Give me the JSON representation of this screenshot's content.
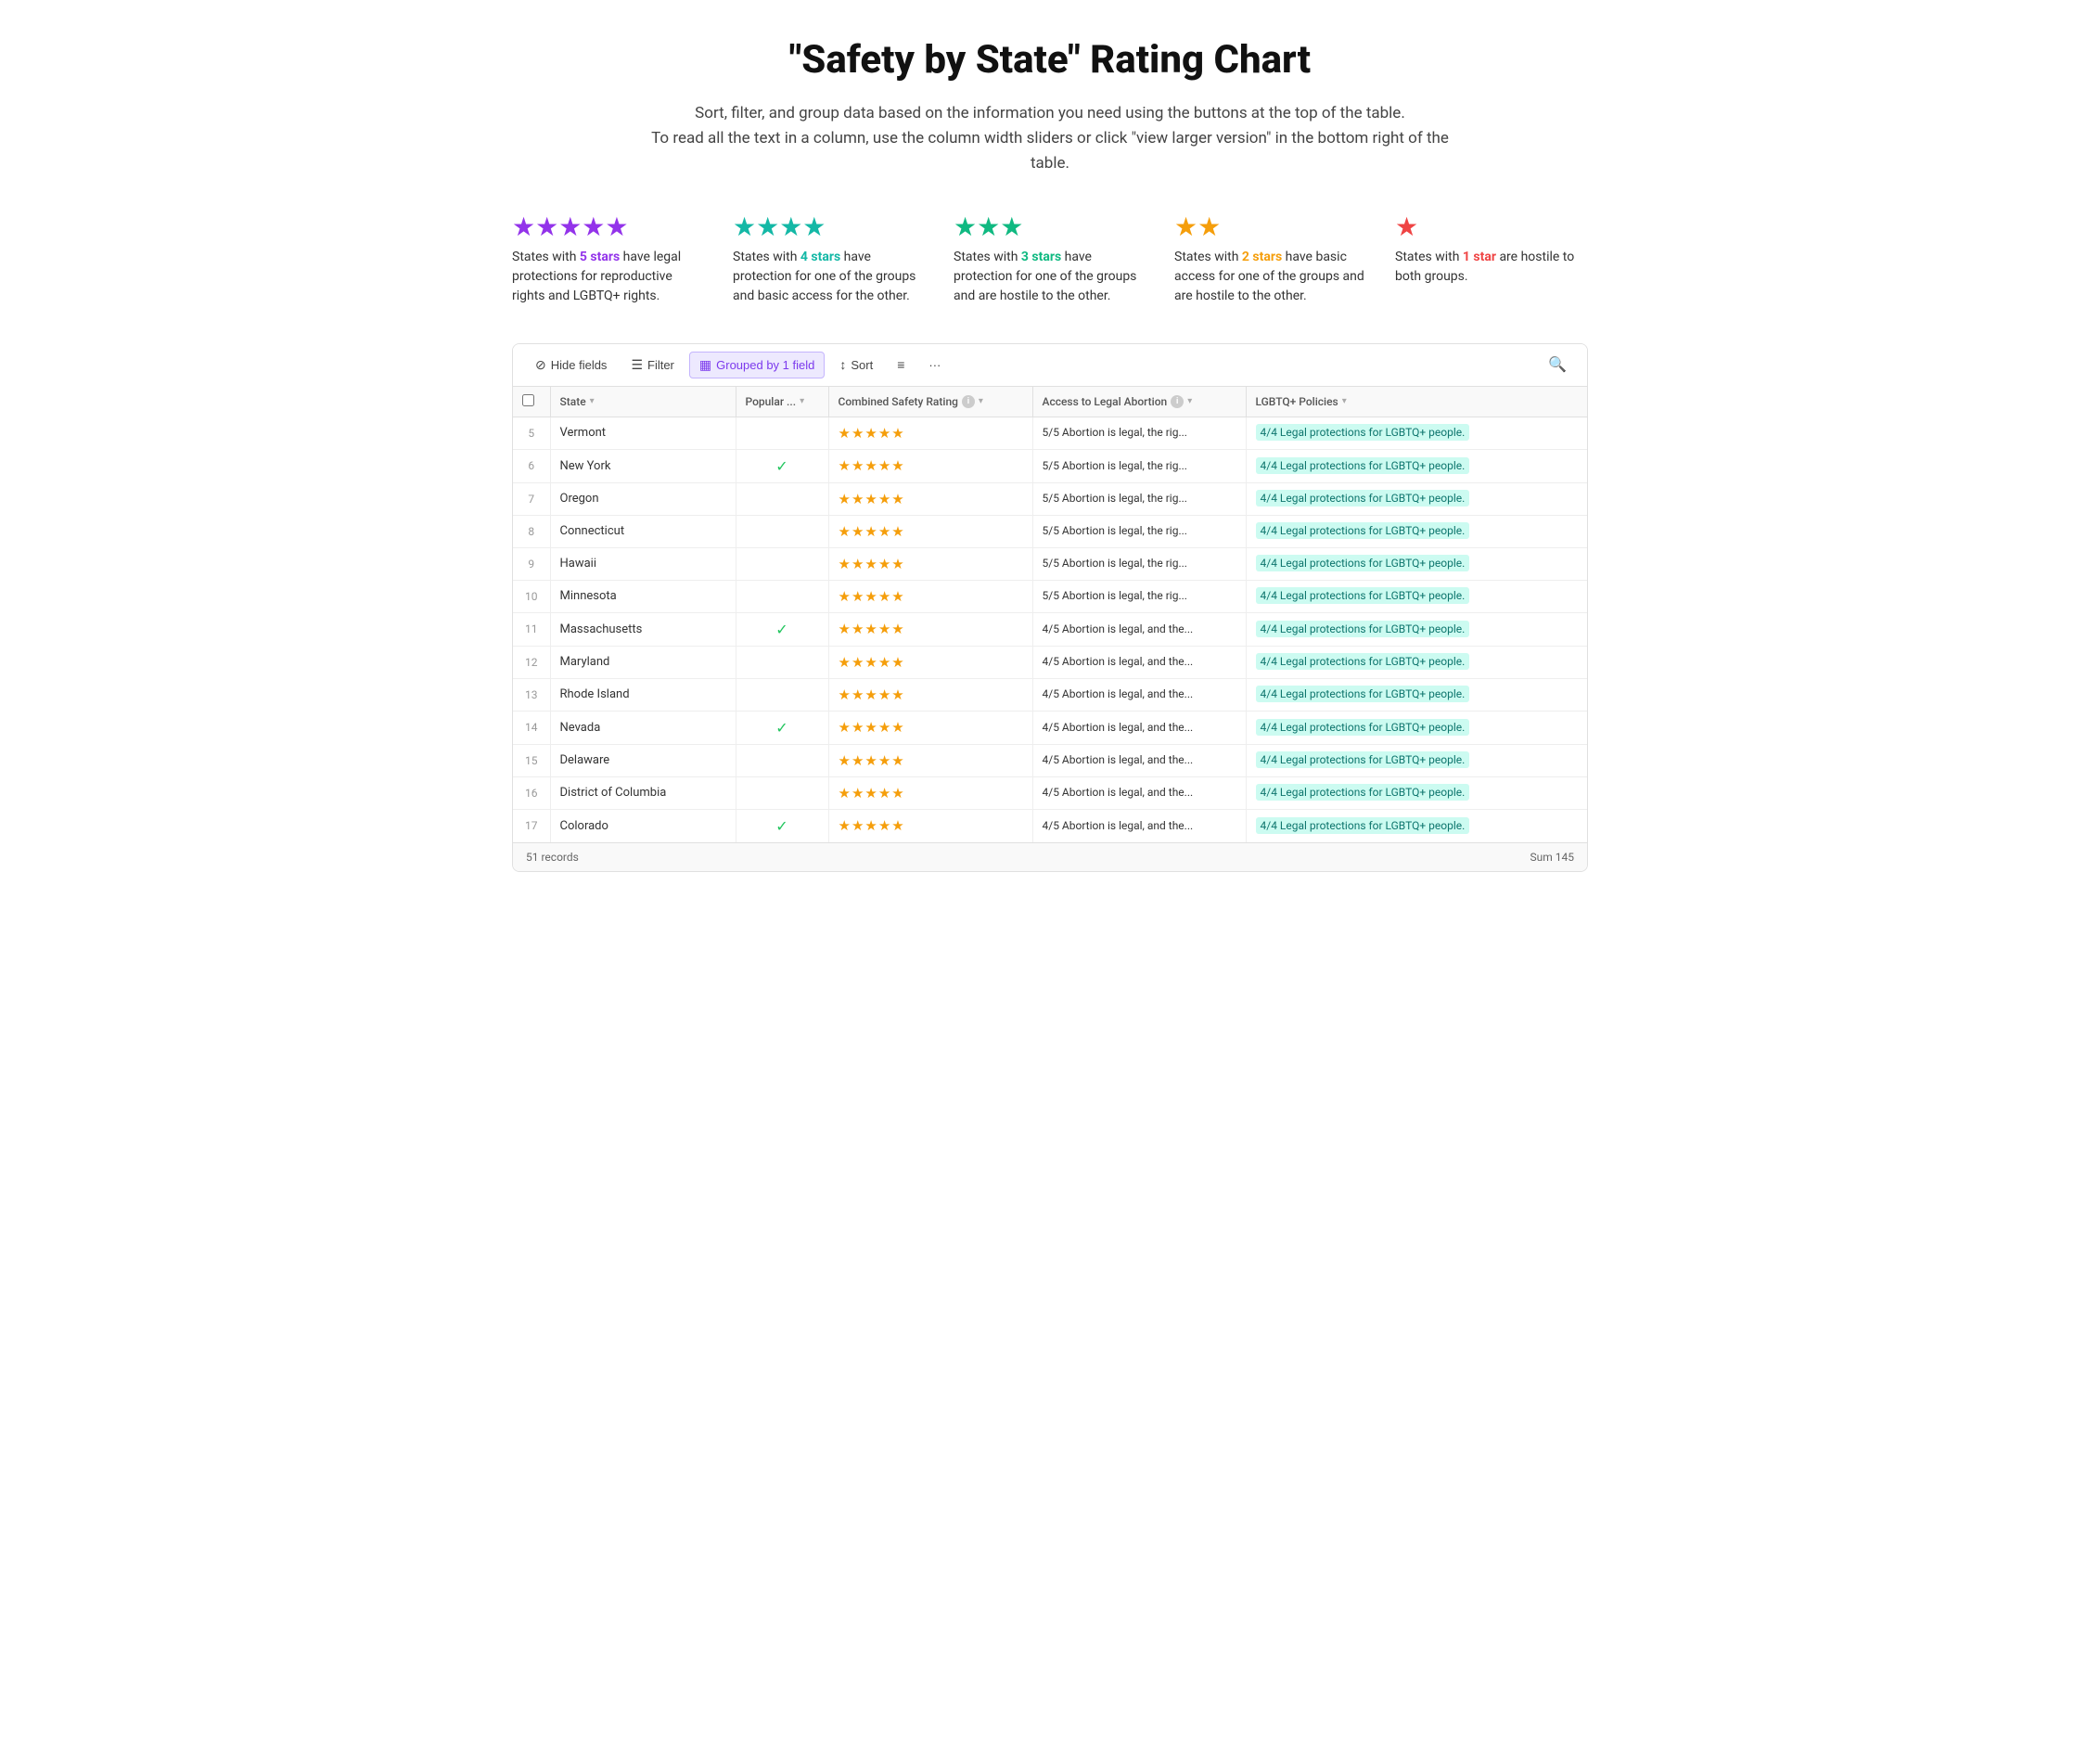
{
  "header": {
    "title": "\"Safety by State\" Rating Chart",
    "subtitle_line1": "Sort, filter, and group data based on the information you need using the buttons at the top of the table.",
    "subtitle_line2": "To read all the text in a column, use the column width sliders or click \"view larger version\" in the bottom right of the",
    "subtitle_line3": "table."
  },
  "legend": [
    {
      "stars": "★★★★★",
      "star_class": "star-purple",
      "text_before": "States with ",
      "stars_label": "5 stars",
      "highlight_class": "highlight-5",
      "text_after": " have legal protections for reproductive rights and LGBTQ+ rights."
    },
    {
      "stars": "★★★★",
      "star_class": "star-teal",
      "text_before": "States with ",
      "stars_label": "4 stars",
      "highlight_class": "highlight-4",
      "text_after": " have protection for one of the groups and basic access for the other."
    },
    {
      "stars": "★★★",
      "star_class": "star-green",
      "text_before": "States with ",
      "stars_label": "3 stars",
      "highlight_class": "highlight-3",
      "text_after": " have protection for one of the groups and are hostile to the other."
    },
    {
      "stars": "★★",
      "star_class": "star-orange",
      "text_before": "States with ",
      "stars_label": "2 stars",
      "highlight_class": "highlight-2",
      "text_after": " have basic access for one of the groups and are hostile to the other."
    },
    {
      "stars": "★",
      "star_class": "star-red",
      "text_before": "States with ",
      "stars_label": "1 star",
      "highlight_class": "highlight-1",
      "text_after": " are hostile to both groups."
    }
  ],
  "toolbar": {
    "hide_fields_label": "Hide fields",
    "filter_label": "Filter",
    "grouped_label": "Grouped by 1 field",
    "sort_label": "Sort",
    "fields_icon_label": "fields-icon",
    "more_label": "···"
  },
  "table": {
    "columns": {
      "num": "#",
      "state": "State",
      "popular": "Popular ...",
      "rating": "Combined Safety Rating",
      "abortion": "Access to Legal Abortion",
      "lgbtq": "LGBTQ+ Policies"
    },
    "rows": [
      {
        "num": 5,
        "state": "Vermont",
        "popular": false,
        "stars": "★★★★★",
        "abortion": "5/5 Abortion is legal, the rig...",
        "lgbtq": "4/4 Legal protections for LGBTQ+ people."
      },
      {
        "num": 6,
        "state": "New York",
        "popular": true,
        "stars": "★★★★★",
        "abortion": "5/5 Abortion is legal, the rig...",
        "lgbtq": "4/4 Legal protections for LGBTQ+ people."
      },
      {
        "num": 7,
        "state": "Oregon",
        "popular": false,
        "stars": "★★★★★",
        "abortion": "5/5 Abortion is legal, the rig...",
        "lgbtq": "4/4 Legal protections for LGBTQ+ people."
      },
      {
        "num": 8,
        "state": "Connecticut",
        "popular": false,
        "stars": "★★★★★",
        "abortion": "5/5 Abortion is legal, the rig...",
        "lgbtq": "4/4 Legal protections for LGBTQ+ people."
      },
      {
        "num": 9,
        "state": "Hawaii",
        "popular": false,
        "stars": "★★★★★",
        "abortion": "5/5 Abortion is legal, the rig...",
        "lgbtq": "4/4 Legal protections for LGBTQ+ people."
      },
      {
        "num": 10,
        "state": "Minnesota",
        "popular": false,
        "stars": "★★★★★",
        "abortion": "5/5 Abortion is legal, the rig...",
        "lgbtq": "4/4 Legal protections for LGBTQ+ people."
      },
      {
        "num": 11,
        "state": "Massachusetts",
        "popular": true,
        "stars": "★★★★★",
        "abortion": "4/5 Abortion is legal, and the...",
        "lgbtq": "4/4 Legal protections for LGBTQ+ people."
      },
      {
        "num": 12,
        "state": "Maryland",
        "popular": false,
        "stars": "★★★★★",
        "abortion": "4/5 Abortion is legal, and the...",
        "lgbtq": "4/4 Legal protections for LGBTQ+ people."
      },
      {
        "num": 13,
        "state": "Rhode Island",
        "popular": false,
        "stars": "★★★★★",
        "abortion": "4/5 Abortion is legal, and the...",
        "lgbtq": "4/4 Legal protections for LGBTQ+ people."
      },
      {
        "num": 14,
        "state": "Nevada",
        "popular": true,
        "stars": "★★★★★",
        "abortion": "4/5 Abortion is legal, and the...",
        "lgbtq": "4/4 Legal protections for LGBTQ+ people."
      },
      {
        "num": 15,
        "state": "Delaware",
        "popular": false,
        "stars": "★★★★★",
        "abortion": "4/5 Abortion is legal, and the...",
        "lgbtq": "4/4 Legal protections for LGBTQ+ people."
      },
      {
        "num": 16,
        "state": "District of Columbia",
        "popular": false,
        "stars": "★★★★★",
        "abortion": "4/5 Abortion is legal, and the...",
        "lgbtq": "4/4 Legal protections for LGBTQ+ people."
      },
      {
        "num": 17,
        "state": "Colorado",
        "popular": true,
        "stars": "★★★★★",
        "abortion": "4/5 Abortion is legal, and the...",
        "lgbtq": "4/4 Legal protections for LGBTQ+ people."
      }
    ],
    "footer": {
      "records": "51 records",
      "sum_label": "Sum 145"
    }
  }
}
